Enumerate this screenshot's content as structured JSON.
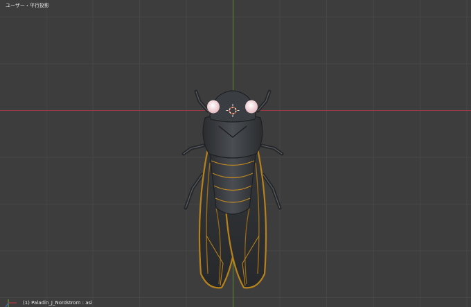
{
  "viewport": {
    "view_mode_label": "ユーザー・平行投影",
    "object_info": "(1) Paladin_J_Nordstrom : asi"
  },
  "scene": {
    "subject": "cicada-model",
    "colors": {
      "background": "#3d3d3d",
      "grid_line": "#474747",
      "axis_x": "#9b3b45",
      "axis_y": "#5c8a2e",
      "body": "#3c3f44",
      "body_shadow": "#25272a",
      "wing_vein": "#b7821c",
      "eye": "#f0d2d6",
      "leg": "#2c2e31"
    }
  }
}
